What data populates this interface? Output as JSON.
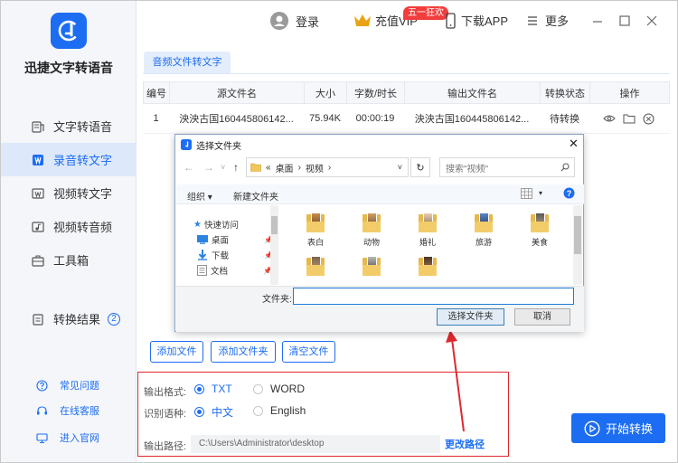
{
  "app": {
    "name": "迅捷文字转语音"
  },
  "sidebar": {
    "items": [
      {
        "label": "文字转语音",
        "icon": "text-to-speech-icon",
        "active": false
      },
      {
        "label": "录音转文字",
        "icon": "audio-to-text-icon",
        "active": true
      },
      {
        "label": "视频转文字",
        "icon": "video-to-text-icon",
        "active": false
      },
      {
        "label": "视频转音频",
        "icon": "video-to-audio-icon",
        "active": false
      },
      {
        "label": "工具箱",
        "icon": "toolbox-icon",
        "active": false
      }
    ],
    "results": {
      "label": "转换结果",
      "count": "2"
    },
    "help": [
      {
        "label": "常见问题",
        "icon": "question-icon"
      },
      {
        "label": "在线客服",
        "icon": "headset-icon"
      },
      {
        "label": "进入官网",
        "icon": "monitor-icon"
      }
    ]
  },
  "topbar": {
    "login": "登录",
    "vip": "充值VIP",
    "promo": "五一狂欢",
    "download": "下载APP",
    "more": "更多"
  },
  "tab": {
    "label": "音频文件转文字"
  },
  "table": {
    "headers": [
      "编号",
      "源文件名",
      "大小",
      "字数/时长",
      "输出文件名",
      "转换状态",
      "操作"
    ],
    "rows": [
      {
        "no": "1",
        "source": "泱泱古国160445806142...",
        "size": "75.94K",
        "duration": "00:00:19",
        "output": "泱泱古国160445806142...",
        "status": "待转换"
      }
    ]
  },
  "actions": {
    "add_file": "添加文件",
    "add_folder": "添加文件夹",
    "clear": "清空文件"
  },
  "output": {
    "format_label": "输出格式:",
    "format_options": [
      "TXT",
      "WORD"
    ],
    "format_selected": "TXT",
    "lang_label": "识别语种:",
    "lang_options": [
      "中文",
      "English"
    ],
    "lang_selected": "中文",
    "path_label": "输出路径:",
    "path_value": "C:\\Users\\Administrator\\desktop",
    "change_path": "更改路径"
  },
  "start_button": "开始转换",
  "dialog": {
    "title": "选择文件夹",
    "breadcrumb": [
      "«",
      "桌面",
      "视频"
    ],
    "search_placeholder": "搜索\"视频\"",
    "organize": "组织 ▾",
    "new_folder": "新建文件夹",
    "tree": [
      {
        "label": "快速访问",
        "icon": "star-icon"
      },
      {
        "label": "桌面",
        "icon": "desktop-icon"
      },
      {
        "label": "下载",
        "icon": "download-arrow-icon"
      },
      {
        "label": "文档",
        "icon": "document-icon"
      }
    ],
    "folders": [
      "表白",
      "动物",
      "婚礼",
      "旅游",
      "美食",
      "",
      "",
      ""
    ],
    "folder_field_label": "文件夹:",
    "folder_field_value": "",
    "select_button": "选择文件夹",
    "cancel_button": "取消"
  },
  "colors": {
    "accent": "#1c6df2",
    "highlight": "#e0282e",
    "vip_gold": "#e8a317"
  }
}
